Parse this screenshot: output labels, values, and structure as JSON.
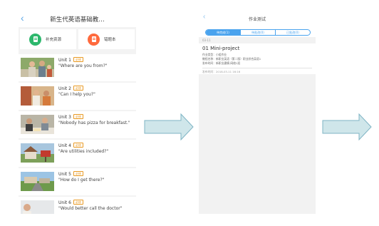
{
  "screen1": {
    "title": "新生代英语基础教…",
    "back_icon": "chevron-left-icon",
    "buttons": [
      {
        "label": "补充资源",
        "icon": "document-icon",
        "color": "#2db86d"
      },
      {
        "label": "错题本",
        "icon": "notebook-icon",
        "color": "#ff6a3d"
      }
    ],
    "units": [
      {
        "name": "Unit 1",
        "badge": "必修",
        "desc": "\"Where are you from?\""
      },
      {
        "name": "Unit 2",
        "badge": "必修",
        "desc": "\"Can I help you?\""
      },
      {
        "name": "Unit 3",
        "badge": "必修",
        "desc": "\"Nobody has pizza for breakfast.\""
      },
      {
        "name": "Unit 4",
        "badge": "必修",
        "desc": "\"Are utilities included?\""
      },
      {
        "name": "Unit 5",
        "badge": "必修",
        "desc": "\"How do I get there?\""
      },
      {
        "name": "Unit 6",
        "badge": "必修",
        "desc": "\"Would better call the doctor\""
      }
    ]
  },
  "screen2": {
    "title": "作业测试",
    "back_icon": "chevron-left-icon",
    "tabs": [
      "待完成(1)",
      "待批改(0)",
      "已批改(0)"
    ],
    "date_group": "03-11",
    "card": {
      "title": "01 Mini-project",
      "rows": [
        "作业类型：小组作业",
        "教程名称：新职业英语（第二版）职业综合英语1",
        "发布时间：新职业建模-网络1班"
      ],
      "time": "发布时间：2018-03-11 16:16"
    }
  },
  "colors": {
    "accent": "#4aa3ee",
    "arrow_fill": "#cfe6ea",
    "arrow_stroke": "#7fb4c4",
    "badge": "#e99a24"
  }
}
